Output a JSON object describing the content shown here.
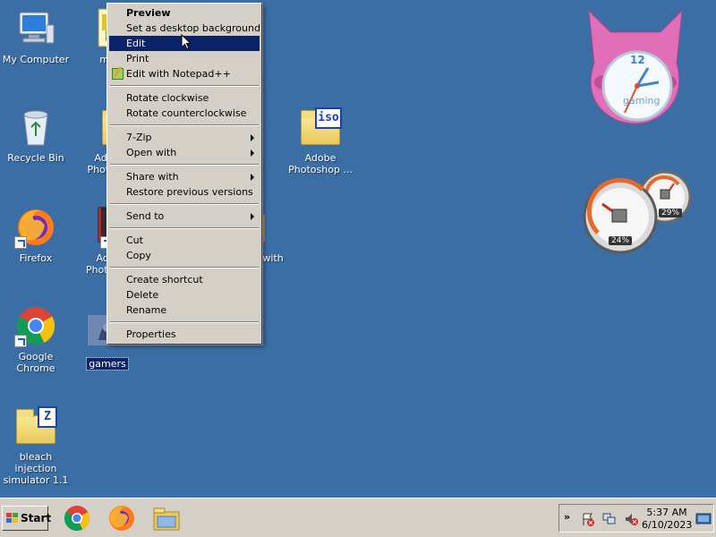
{
  "desktop": {
    "icons": {
      "my_computer": "My Computer",
      "mo": "mo",
      "recycle_bin": "Recycle Bin",
      "adobe_photoshop_folder": "Ado\nPhotos",
      "adobe_photoshop_iso": "Adobe\nPhotoshop ...",
      "firefox": "Firefox",
      "adobe_photoshop_shortcut": "Ado\nPhotosh",
      "with_label": "with",
      "google_chrome": "Google Chrome",
      "gamers": "gamers",
      "bleach": "bleach injection\nsimulator 1.1",
      "iso_badge": "iso",
      "z_badge": "Z"
    }
  },
  "context_menu": {
    "groups": [
      [
        "Preview",
        "Set as desktop background",
        "Edit",
        "Print",
        "Edit with Notepad++"
      ],
      [
        "Rotate clockwise",
        "Rotate counterclockwise"
      ],
      [
        "7-Zip",
        "Open with"
      ],
      [
        "Share with",
        "Restore previous versions"
      ],
      [
        "Send to"
      ],
      [
        "Cut",
        "Copy"
      ],
      [
        "Create shortcut",
        "Delete",
        "Rename"
      ],
      [
        "Properties"
      ]
    ]
  },
  "gadgets": {
    "clock_label": "gaming",
    "clock_12": "12",
    "cpu_percent": "24%",
    "memory_percent": "29%"
  },
  "taskbar": {
    "start_label": "Start",
    "time": "5:37 AM",
    "date": "6/10/2023",
    "tray_expand": "»"
  },
  "colors": {
    "desktop": "#3a6ea5",
    "menu_highlight": "#0a246a",
    "taskbar": "#d4d0c8"
  }
}
